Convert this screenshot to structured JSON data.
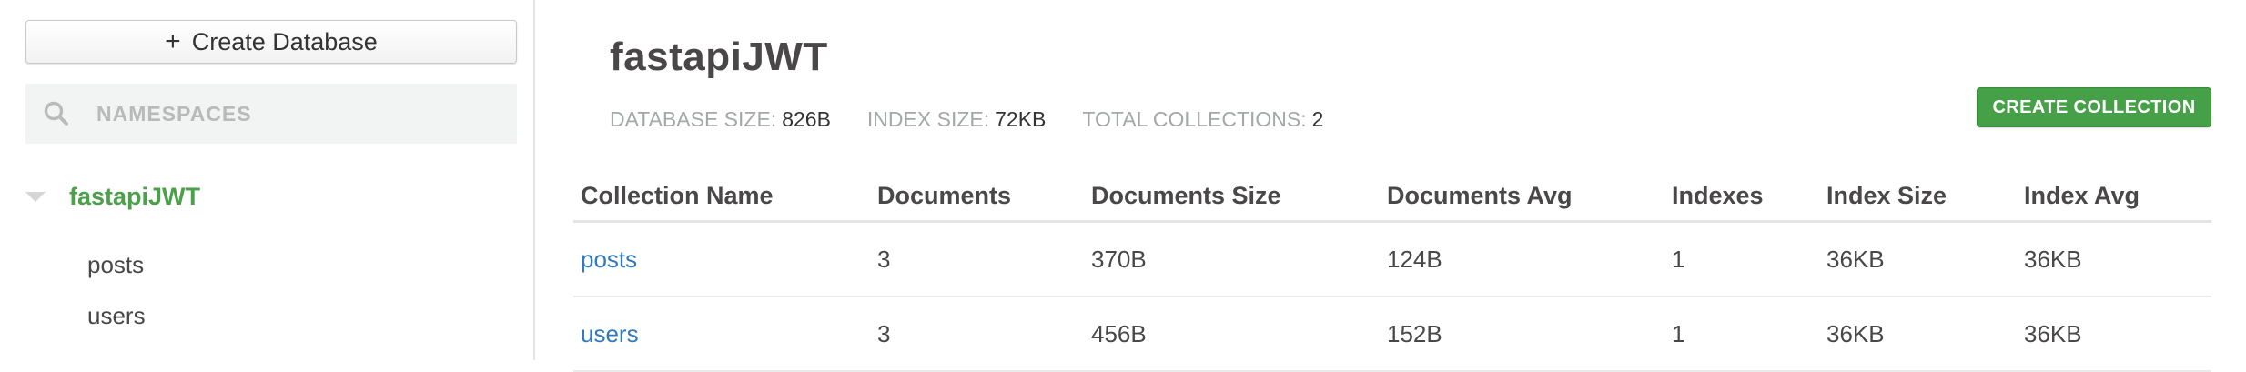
{
  "sidebar": {
    "create_database_label": "Create Database",
    "search_placeholder": "NAMESPACES",
    "database": {
      "name": "fastapiJWT",
      "collections": [
        "posts",
        "users"
      ]
    }
  },
  "main": {
    "title": "fastapiJWT",
    "stats": {
      "database_size_label": "DATABASE SIZE:",
      "database_size": "826B",
      "index_size_label": "INDEX SIZE:",
      "index_size": "72KB",
      "total_collections_label": "TOTAL COLLECTIONS:",
      "total_collections": "2"
    },
    "create_collection_label": "CREATE COLLECTION",
    "table": {
      "headers": [
        "Collection Name",
        "Documents",
        "Documents Size",
        "Documents Avg",
        "Indexes",
        "Index Size",
        "Index Avg"
      ],
      "rows": [
        [
          "posts",
          "3",
          "370B",
          "124B",
          "1",
          "36KB",
          "36KB"
        ],
        [
          "users",
          "3",
          "456B",
          "152B",
          "1",
          "36KB",
          "36KB"
        ]
      ]
    }
  },
  "colors": {
    "accent_green": "#45a047",
    "db_name_green": "#4ba04a",
    "link_blue": "#337ab7"
  }
}
